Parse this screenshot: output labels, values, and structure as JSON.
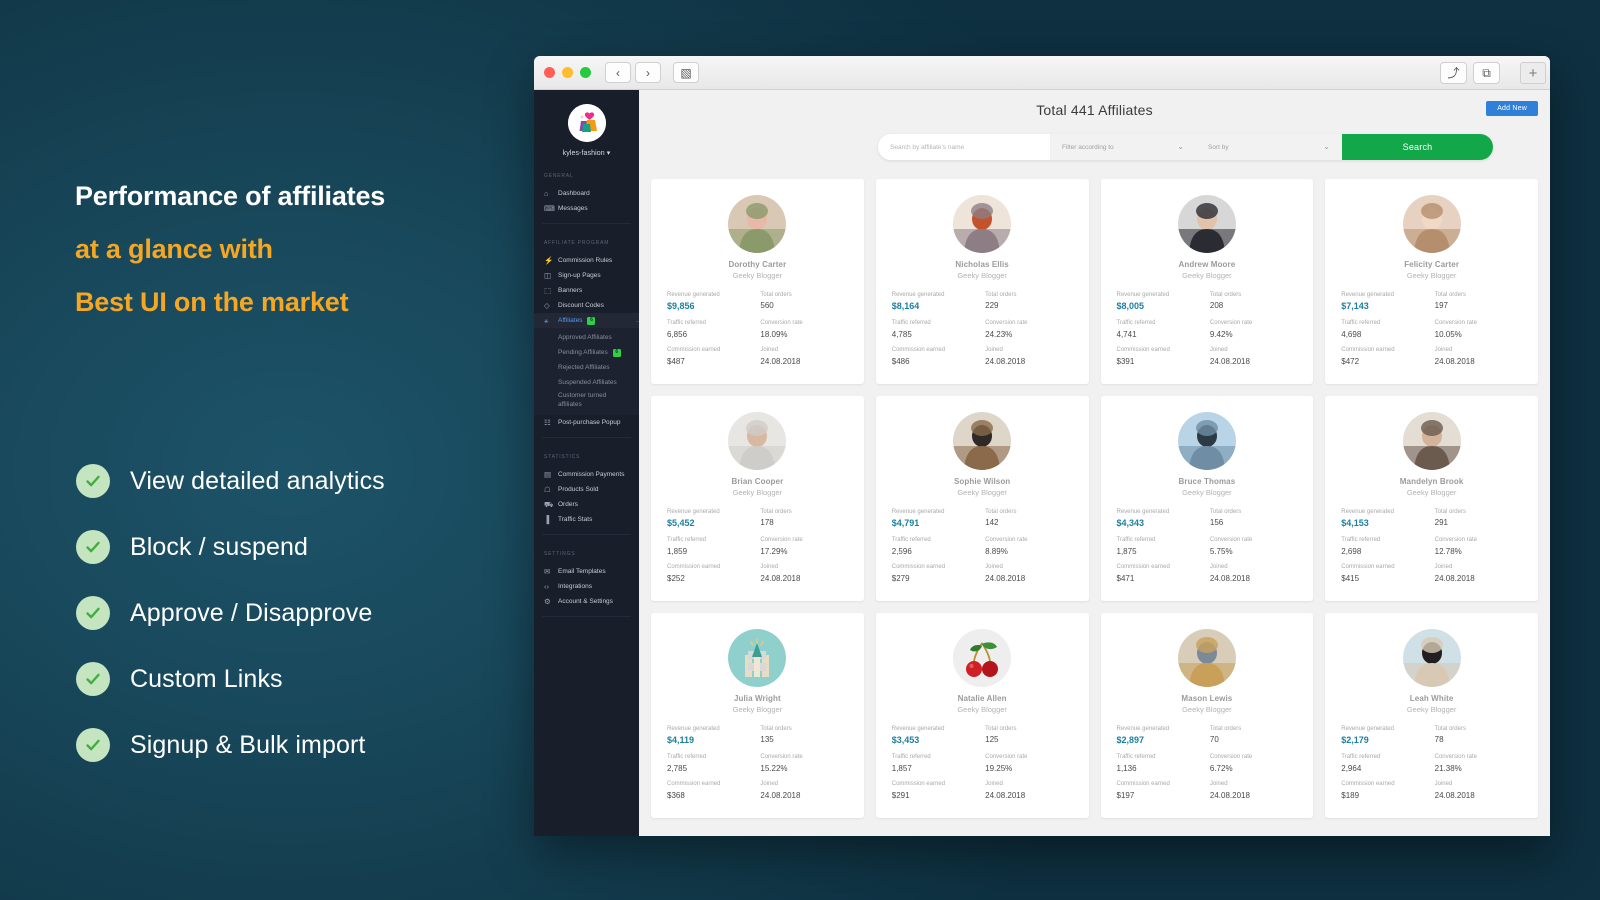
{
  "marketing": {
    "headline_line1": "Performance of affiliates",
    "headline_line2": "at a glance with",
    "headline_line3": "Best UI on the market",
    "features": [
      "View detailed analytics",
      "Block / suspend",
      "Approve / Disapprove",
      "Custom Links",
      "Signup & Bulk import"
    ],
    "colors": {
      "accent": "#f5a623",
      "check": "#3fae3f",
      "check_bg": "#c5e5c0",
      "bg": "#15485c"
    }
  },
  "browser": {
    "back_label": "‹",
    "forward_label": "›",
    "sidebar_toggle_label": "▧",
    "share_label": "⤴",
    "tabs_label": "⧉",
    "new_tab_label": "+"
  },
  "sidebar": {
    "brand": "kyles-fashion ▾",
    "sections": [
      {
        "title": "GENERAL",
        "items": [
          {
            "icon": "home-icon",
            "glyph": "⌂",
            "label": "Dashboard"
          },
          {
            "icon": "message-icon",
            "glyph": "⌨",
            "label": "Messages"
          }
        ]
      },
      {
        "title": "AFFILIATE PROGRAM",
        "items": [
          {
            "icon": "bolt-icon",
            "glyph": "⚡",
            "label": "Commission Rules"
          },
          {
            "icon": "pages-icon",
            "glyph": "◫",
            "label": "Sign-up Pages"
          },
          {
            "icon": "image-icon",
            "glyph": "⬚",
            "label": "Banners"
          },
          {
            "icon": "tag-icon",
            "glyph": "◇",
            "label": "Discount Codes"
          },
          {
            "icon": "user-icon",
            "glyph": "⚹",
            "label": "Affiliates",
            "active": true,
            "badge": "6"
          }
        ],
        "subitems": [
          {
            "label": "Approved Affiliates"
          },
          {
            "label": "Pending Affiliates",
            "badge": "6"
          },
          {
            "label": "Rejected Affiliates"
          },
          {
            "label": "Suspended Affiliates"
          },
          {
            "label": "Customer turned affiliates",
            "two_line": true
          }
        ],
        "after_items": [
          {
            "icon": "popup-icon",
            "glyph": "☷",
            "label": "Post-purchase Popup"
          }
        ]
      },
      {
        "title": "STATISTICS",
        "items": [
          {
            "icon": "money-icon",
            "glyph": "▤",
            "label": "Commission Payments"
          },
          {
            "icon": "box-icon",
            "glyph": "☖",
            "label": "Products Sold"
          },
          {
            "icon": "cart-icon",
            "glyph": "⛟",
            "label": "Orders"
          },
          {
            "icon": "chart-icon",
            "glyph": "▐",
            "label": "Traffic Stats"
          }
        ]
      },
      {
        "title": "SETTINGS",
        "items": [
          {
            "icon": "envelope-icon",
            "glyph": "✉",
            "label": "Email Templates"
          },
          {
            "icon": "code-icon",
            "glyph": "‹›",
            "label": "Integrations"
          },
          {
            "icon": "gear-icon",
            "glyph": "⚙",
            "label": "Account & Settings"
          }
        ]
      }
    ]
  },
  "header": {
    "title": "Total 441 Affiliates",
    "add_new_label": "Add New"
  },
  "search": {
    "input_placeholder": "Search by affiliate's name",
    "input_value": "",
    "filter_label": "Filter according to",
    "sort_label": "Sort by",
    "search_button": "Search",
    "chevron": "⌄"
  },
  "card_labels": {
    "revenue": "Revenue generated",
    "orders": "Total orders",
    "traffic": "Traffic referred",
    "conversion": "Conversion rate",
    "commission": "Commission earned",
    "joined": "Joined"
  },
  "affiliates": [
    {
      "name": "Dorothy Carter",
      "role": "Geeky Blogger",
      "revenue": "$9,856",
      "orders": "560",
      "traffic": "6,856",
      "conversion": "18.09%",
      "commission": "$487",
      "joined": "24.08.2018",
      "avatar_type": "photo",
      "avatar_colors": [
        "#d9c8b4",
        "#8a9a6a",
        "#e8b9a6"
      ]
    },
    {
      "name": "Nicholas Ellis",
      "role": "Geeky Blogger",
      "revenue": "$8,164",
      "orders": "229",
      "traffic": "4,785",
      "conversion": "24.23%",
      "commission": "$486",
      "joined": "24.08.2018",
      "avatar_type": "photo",
      "avatar_colors": [
        "#efe4da",
        "#8d7e86",
        "#c4522a"
      ]
    },
    {
      "name": "Andrew Moore",
      "role": "Geeky Blogger",
      "revenue": "$8,005",
      "orders": "208",
      "traffic": "4,741",
      "conversion": "9.42%",
      "commission": "$391",
      "joined": "24.08.2018",
      "avatar_type": "photo",
      "avatar_colors": [
        "#d7d7d7",
        "#2b2b33",
        "#e0c3a8"
      ]
    },
    {
      "name": "Felicity Carter",
      "role": "Geeky Blogger",
      "revenue": "$7,143",
      "orders": "197",
      "traffic": "4,698",
      "conversion": "10.05%",
      "commission": "$472",
      "joined": "24.08.2018",
      "avatar_type": "photo",
      "avatar_colors": [
        "#e7d2c2",
        "#b58f6d",
        "#f0d9c6"
      ]
    },
    {
      "name": "Brian Cooper",
      "role": "Geeky Blogger",
      "revenue": "$5,452",
      "orders": "178",
      "traffic": "1,859",
      "conversion": "17.29%",
      "commission": "$252",
      "joined": "24.08.2018",
      "avatar_type": "photo",
      "avatar_colors": [
        "#e8e6e2",
        "#cfcdc9",
        "#d8b8a0"
      ]
    },
    {
      "name": "Sophie Wilson",
      "role": "Geeky Blogger",
      "revenue": "$4,791",
      "orders": "142",
      "traffic": "2,596",
      "conversion": "8.89%",
      "commission": "$279",
      "joined": "24.08.2018",
      "avatar_type": "photo",
      "avatar_colors": [
        "#ded6c8",
        "#8a6a4a",
        "#2f2a28"
      ]
    },
    {
      "name": "Bruce Thomas",
      "role": "Geeky Blogger",
      "revenue": "$4,343",
      "orders": "156",
      "traffic": "1,875",
      "conversion": "5.75%",
      "commission": "$471",
      "joined": "24.08.2018",
      "avatar_type": "photo",
      "avatar_colors": [
        "#b9d4e6",
        "#6f8ea6",
        "#2c3a44"
      ]
    },
    {
      "name": "Mandelyn Brook",
      "role": "Geeky Blogger",
      "revenue": "$4,153",
      "orders": "291",
      "traffic": "2,698",
      "conversion": "12.78%",
      "commission": "$415",
      "joined": "24.08.2018",
      "avatar_type": "photo",
      "avatar_colors": [
        "#e3ddd4",
        "#6b5a4e",
        "#d3b49a"
      ]
    },
    {
      "name": "Julia Wright",
      "role": "Geeky Blogger",
      "revenue": "$4,119",
      "orders": "135",
      "traffic": "2,785",
      "conversion": "15.22%",
      "commission": "$368",
      "joined": "24.08.2018",
      "avatar_type": "illustration-pencils",
      "avatar_colors": [
        "#8fd0cc",
        "#e8c87a",
        "#3b9e92"
      ]
    },
    {
      "name": "Natalie Allen",
      "role": "Geeky Blogger",
      "revenue": "$3,453",
      "orders": "125",
      "traffic": "1,857",
      "conversion": "19.25%",
      "commission": "$291",
      "joined": "24.08.2018",
      "avatar_type": "illustration-cherries",
      "avatar_colors": [
        "#eeeeee",
        "#cf2027",
        "#3f8f3a"
      ]
    },
    {
      "name": "Mason Lewis",
      "role": "Geeky Blogger",
      "revenue": "$2,897",
      "orders": "70",
      "traffic": "1,136",
      "conversion": "6.72%",
      "commission": "$197",
      "joined": "24.08.2018",
      "avatar_type": "photo",
      "avatar_colors": [
        "#d8cdb8",
        "#c9a05a",
        "#7b8a99"
      ]
    },
    {
      "name": "Leah White",
      "role": "Geeky Blogger",
      "revenue": "$2,179",
      "orders": "78",
      "traffic": "2,964",
      "conversion": "21.38%",
      "commission": "$189",
      "joined": "24.08.2018",
      "avatar_type": "photo",
      "avatar_colors": [
        "#cfe0e6",
        "#d8c9b4",
        "#231f20"
      ]
    }
  ]
}
